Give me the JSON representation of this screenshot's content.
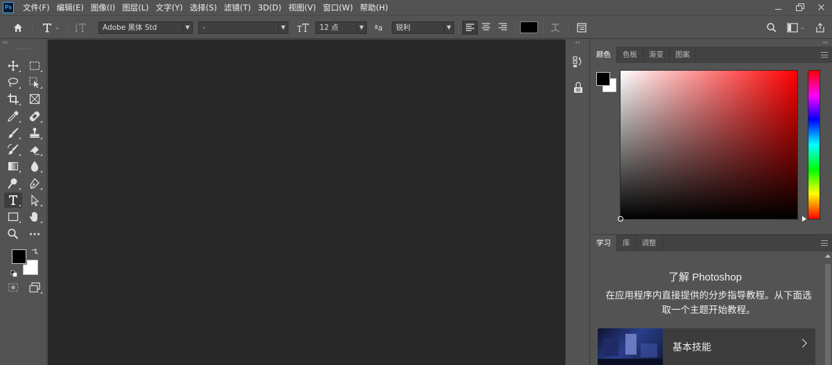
{
  "app": {
    "logo": "Ps"
  },
  "menu": [
    "文件(F)",
    "编辑(E)",
    "图像(I)",
    "图层(L)",
    "文字(Y)",
    "选择(S)",
    "滤镜(T)",
    "3D(D)",
    "视图(V)",
    "窗口(W)",
    "帮助(H)"
  ],
  "options": {
    "font_family": "Adobe 黑体 Std",
    "font_style": "-",
    "font_size": "12 点",
    "antialias_label": "ªa",
    "antialias": "锐利",
    "text_color": "#000000"
  },
  "collapse": {
    "left": "‹‹",
    "dock": "‹‹",
    "panel": "‹‹"
  },
  "tools": [
    "move",
    "marquee",
    "lasso",
    "object-select",
    "crop",
    "frame",
    "eyedropper",
    "healing",
    "brush",
    "stamp",
    "history-brush",
    "eraser",
    "gradient",
    "blur",
    "dodge",
    "pen",
    "type",
    "path-select",
    "rectangle",
    "hand",
    "zoom",
    "more"
  ],
  "colors": {
    "foreground": "#000000",
    "background": "#ffffff"
  },
  "color_panel": {
    "tabs": [
      "颜色",
      "色板",
      "渐变",
      "图案"
    ],
    "active_tab": 0,
    "hue": "#ff0000"
  },
  "learn_panel": {
    "tabs": [
      "学习",
      "库",
      "调整"
    ],
    "title": "了解 Photoshop",
    "description": "在应用程序内直接提供的分步指导教程。从下面选取一个主题开始教程。",
    "card_label": "基本技能"
  }
}
